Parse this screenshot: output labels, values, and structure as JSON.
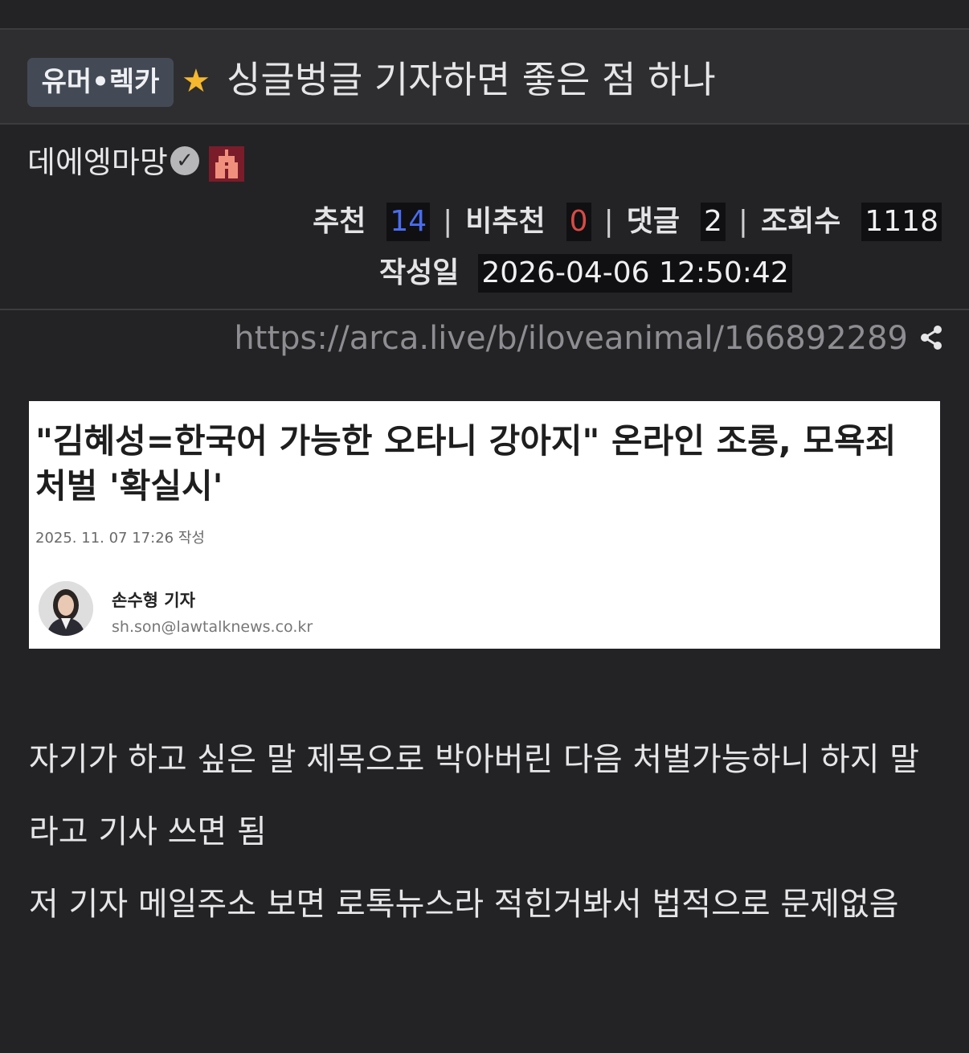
{
  "header": {
    "category": "유머•렉카",
    "title": "싱글벙글 기자하면 좋은 점 하나",
    "star_color": "#f5b82e"
  },
  "author": {
    "name": "데에엥마망",
    "verified_icon": "check-circle-icon",
    "avatar_icon": "pixel-avatar-icon"
  },
  "stats": {
    "recommend_label": "추천",
    "recommend_value": "14",
    "downvote_label": "비추천",
    "downvote_value": "0",
    "comments_label": "댓글",
    "comments_value": "2",
    "views_label": "조회수",
    "views_value": "1118",
    "separator": "|",
    "date_label": "작성일",
    "date_value": "2026-04-06 12:50:42"
  },
  "link": {
    "url": "https://arca.live/b/iloveanimal/166892289",
    "share_icon": "share-icon"
  },
  "article_image": {
    "headline": "\"김혜성=한국어 가능한 오타니 강아지\" 온라인 조롱, 모욕죄 처벌 '확실시'",
    "published": "2025. 11. 07 17:26 작성",
    "reporter_name": "손수형 기자",
    "reporter_email": "sh.son@lawtalknews.co.kr"
  },
  "body": {
    "lines": [
      "자기가 하고 싶은 말 제목으로 박아버린 다음 처벌가능하니 하지 말라고 기사 쓰면 됨",
      "저 기자 메일주소 보면 로톡뉴스라 적힌거봐서 법적으로 문제없음"
    ]
  },
  "colors": {
    "background": "#232325",
    "recommend": "#4a6cf0",
    "downvote": "#d84b45"
  }
}
